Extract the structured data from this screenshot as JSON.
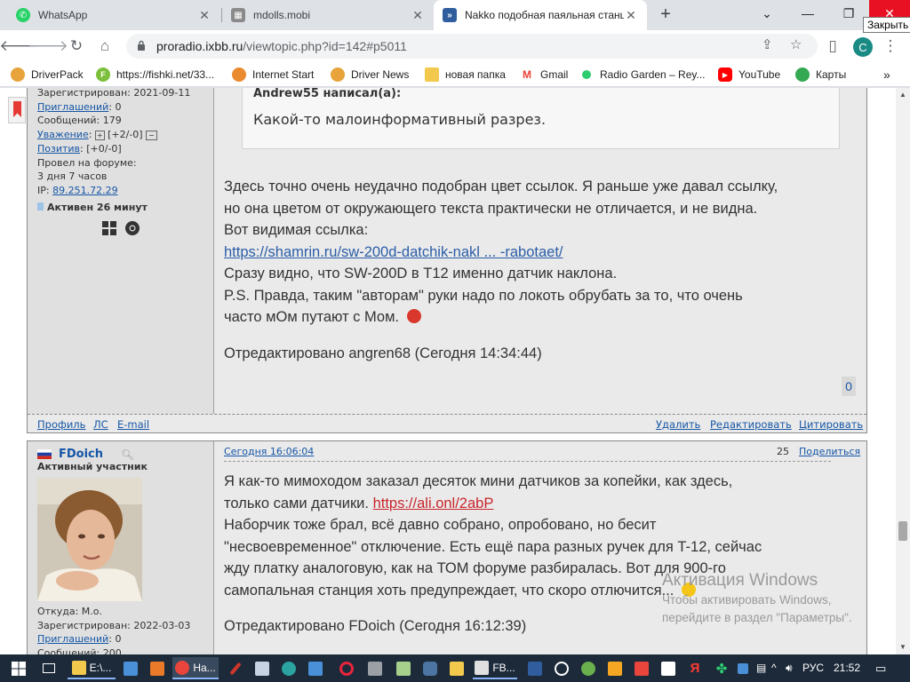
{
  "tabs": [
    {
      "title": "WhatsApp",
      "fav_color": "#25d366"
    },
    {
      "title": "mdolls.mobi",
      "fav_color": "#6d6d6d"
    },
    {
      "title": "Nakko подобная паяльная станц",
      "fav_color": "#2f5d9e"
    }
  ],
  "window": {
    "tooltip": "Закрыть"
  },
  "address": {
    "host": "proradio.ixbb.ru",
    "path": "/viewtopic.php?id=142#p5011"
  },
  "profile": {
    "initial": "C"
  },
  "bookmarks": [
    {
      "label": "DriverPack",
      "color": "#e8a33a"
    },
    {
      "label": "https://fishki.net/33...",
      "color": "#7cbf3a",
      "glyph": "F"
    },
    {
      "label": "Internet Start",
      "color": "#ea8a2e"
    },
    {
      "label": "Driver News",
      "color": "#e8a33a"
    },
    {
      "label": "новая папка",
      "color": "#f2c94c"
    },
    {
      "label": "Gmail",
      "color": "#ea4335",
      "glyph": "M"
    },
    {
      "label": "Radio Garden – Rey...",
      "color": "#2ecc71"
    },
    {
      "label": "YouTube",
      "color": "#ff0000",
      "glyph": "▶"
    },
    {
      "label": "Карты",
      "color": "#34a853"
    }
  ],
  "post1": {
    "registered": "Зарегистрирован: 2021-09-11",
    "invites_label": "Приглашений",
    "invites_value": ": 0",
    "messages": "Сообщений: 179",
    "respect_label": "Уважение",
    "respect_value": "[+2/-0]",
    "positive_label": "Позитив",
    "positive_value": ": [+0/-0]",
    "forum_time_label": "Провел на форуме:",
    "forum_time_value": "3 дня 7 часов",
    "ip_label": "IP:",
    "ip_value": "89.251.72.29",
    "active": "Активен 26 минут",
    "quote_author": "Andrew55 написал(а):",
    "quote_text": "Какой-то малоинформативный разрез.",
    "lines": [
      "Здесь точно очень неудачно подобран цвет ссылок. Я раньше уже давал ссылку,",
      "но она цветом от окружающего текста практически не отличается, и не видна.",
      "Вот видимая ссылка:"
    ],
    "link": "https://shamrin.ru/sw-200d-datchik-nakl ... -rabotaet/",
    "lines2": [
      "Сразу видно, что SW-200D в T12 именно датчик наклона.",
      "P.S. Правда, таким \"авторам\" руки надо по локоть обрубать за то, что очень"
    ],
    "last_line": "часто мОм путают с Мом.",
    "edited": "Отредактировано angren68 (Сегодня 14:34:44)",
    "likes": "0",
    "footer": {
      "profile": "Профиль",
      "pm": "ЛС",
      "email": "E-mail",
      "delete": "Удалить",
      "edit": "Редактировать",
      "quote": "Цитировать"
    }
  },
  "post2": {
    "author": "FDoich",
    "rank": "Активный участник",
    "date": "Сегодня 16:06:04",
    "number": "25",
    "share": "Поделиться",
    "from": "Откуда: М.о.",
    "registered": "Зарегистрирован: 2022-03-03",
    "invites_label": "Приглашений",
    "invites_value": ": 0",
    "messages": "Сообщений: 200",
    "line1": "Я как-то мимоходом заказал десяток мини датчиков за копейки, как здесь,",
    "line2": "только сами датчики.",
    "link": "https://ali.onl/2abP",
    "lines": [
      "Наборчик тоже брал, всё давно собрано, опробовано, но бесит",
      "\"несвоевременное\" отключение. Есть ещё пара разных ручек для T-12, сейчас",
      "жду платку аналоговую, как на ТОМ форуме разбиралась. Вот для 900-го"
    ],
    "last_line": "самопальная станция хоть предупреждает, что скоро отлючится...",
    "edited": "Отредактировано FDoich (Сегодня 16:12:39)"
  },
  "watermark": {
    "title": "Активация Windows",
    "line1": "Чтобы активировать Windows,",
    "line2": "перейдите в раздел \"Параметры\"."
  },
  "taskbar": {
    "explorer": "E:\\...",
    "chrome": "На...",
    "fb": "FB...",
    "lang": "РУС",
    "time": "21:52"
  }
}
